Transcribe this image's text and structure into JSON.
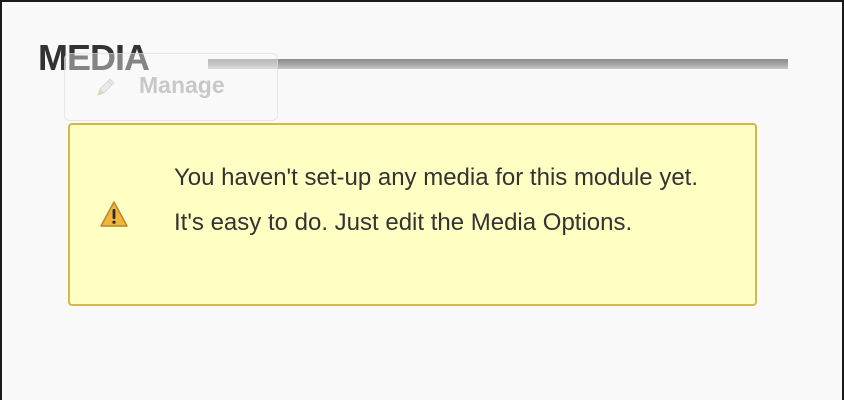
{
  "module": {
    "title": "MEDIA"
  },
  "toolbar": {
    "manage_label": "Manage",
    "manage_icon": "pencil-icon"
  },
  "notice": {
    "icon": "warning-icon",
    "message": "You haven't set-up any media for this module yet. It's easy to do. Just edit the Media Options."
  },
  "colors": {
    "notice_background": "#ffffc4",
    "notice_border": "#d4b94a",
    "warning_icon": "#f2b53a",
    "title_text": "#333333"
  }
}
